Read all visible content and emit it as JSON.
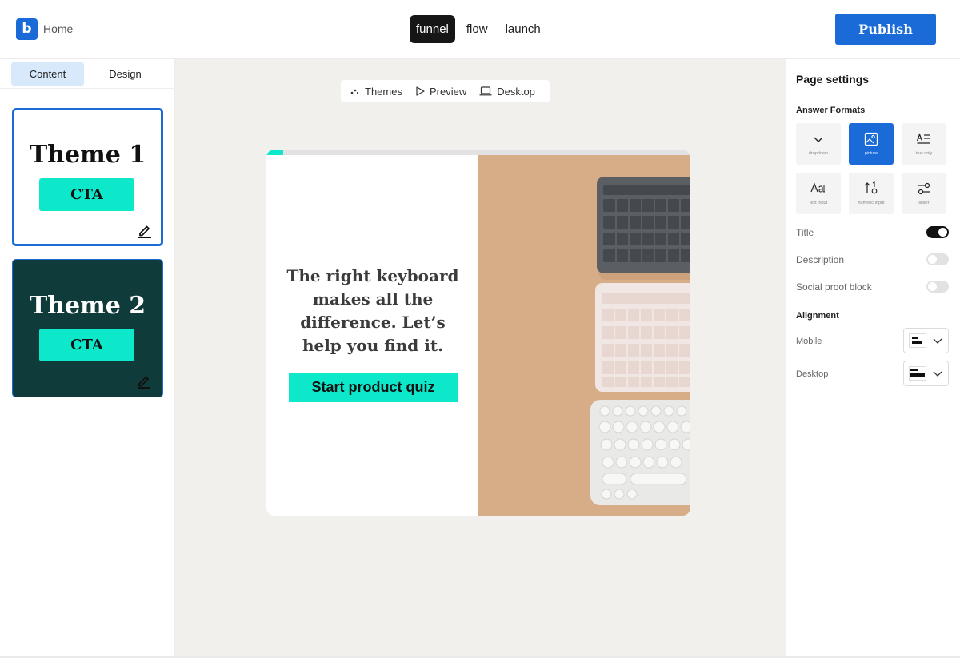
{
  "header": {
    "logo_letter": "b",
    "home_label": "Home",
    "steps": [
      "funnel",
      "flow",
      "launch"
    ],
    "active_step": "funnel",
    "publish_label": "Publish"
  },
  "left_panel": {
    "tabs": [
      "Content",
      "Design"
    ],
    "active_tab": "Content",
    "themes": [
      {
        "title": "Theme 1",
        "cta": "CTA"
      },
      {
        "title": "Theme 2",
        "cta": "CTA"
      }
    ]
  },
  "canvas": {
    "toolbar": {
      "themes": "Themes",
      "preview": "Preview",
      "device": "Desktop"
    },
    "card": {
      "headline": "The right keyboard makes all the difference. Let’s help you find it.",
      "button": "Start product quiz",
      "progress": 0.04
    }
  },
  "right_panel": {
    "title": "Page settings",
    "answer_formats_label": "Answer Formats",
    "formats": [
      {
        "label": "dropdown",
        "icon": "chevron-down-icon",
        "active": false
      },
      {
        "label": "picture",
        "icon": "image-icon",
        "active": true
      },
      {
        "label": "text only",
        "icon": "text-only-icon",
        "active": false
      },
      {
        "label": "text input",
        "icon": "text-input-icon",
        "active": false
      },
      {
        "label": "numeric input",
        "icon": "numeric-input-icon",
        "active": false
      },
      {
        "label": "slider",
        "icon": "slider-icon",
        "active": false
      }
    ],
    "toggles": [
      {
        "label": "Title",
        "on": true
      },
      {
        "label": "Description",
        "on": false
      },
      {
        "label": "Social proof block",
        "on": false
      }
    ],
    "alignment_label": "Alignment",
    "alignment": [
      {
        "label": "Mobile"
      },
      {
        "label": "Desktop"
      }
    ]
  },
  "colors": {
    "brand_blue": "#1a6ad8",
    "accent_teal": "#0de8cb",
    "dark_theme_bg": "#103b3b",
    "canvas_bg": "#f1f0ec",
    "photo_bg": "#d7ad88"
  }
}
